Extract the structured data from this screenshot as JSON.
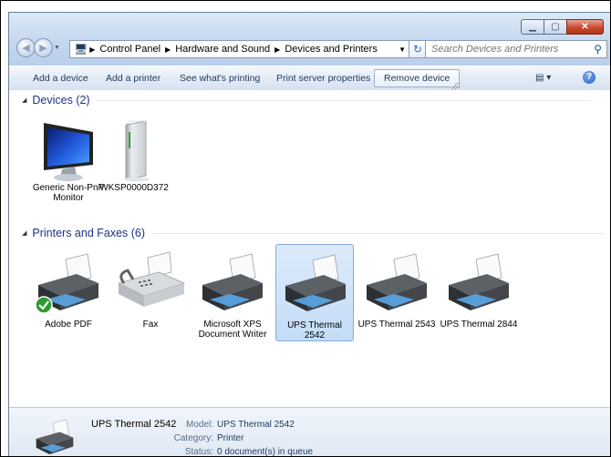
{
  "address": {
    "crumbs": [
      "Control Panel",
      "Hardware and Sound",
      "Devices and Printers"
    ],
    "search_placeholder": "Search Devices and Printers"
  },
  "toolbar": {
    "add_device": "Add a device",
    "add_printer": "Add a printer",
    "see_printing": "See what's printing",
    "print_server": "Print server properties",
    "remove_device": "Remove device"
  },
  "groups": {
    "devices": "Devices (2)",
    "printers": "Printers and Faxes (6)"
  },
  "devices": [
    {
      "label": "Generic Non-PnP Monitor",
      "icon": "monitor-icon"
    },
    {
      "label": "WKSP0000D372",
      "icon": "computer-tower-icon"
    }
  ],
  "printers": [
    {
      "label": "Adobe PDF",
      "icon": "printer-icon",
      "default": true
    },
    {
      "label": "Fax",
      "icon": "fax-icon"
    },
    {
      "label": "Microsoft XPS Document Writer",
      "icon": "printer-icon"
    },
    {
      "label": "UPS Thermal 2542",
      "icon": "printer-icon",
      "selected": true
    },
    {
      "label": "UPS Thermal 2543",
      "icon": "printer-icon"
    },
    {
      "label": "UPS Thermal 2844",
      "icon": "printer-icon"
    }
  ],
  "details": {
    "name": "UPS Thermal 2542",
    "model_label": "Model:",
    "model": "UPS Thermal 2542",
    "category_label": "Category:",
    "category": "Printer",
    "status_label": "Status:",
    "status": "0 document(s) in queue"
  }
}
